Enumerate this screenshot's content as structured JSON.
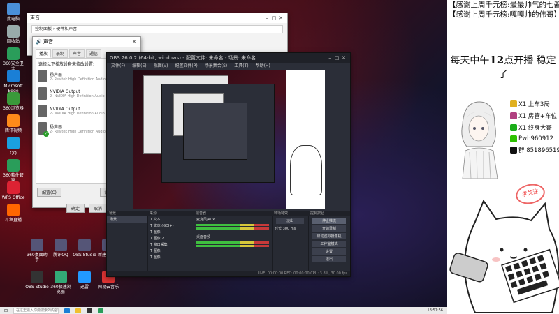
{
  "desktop": {
    "icons": [
      {
        "label": "此电脑",
        "color": "#4a8fd8"
      },
      {
        "label": "回收站",
        "color": "#9aa"
      },
      {
        "label": "360安全卫士",
        "color": "#2a9d5a"
      },
      {
        "label": "Microsoft Edge",
        "color": "#1a7fd6"
      },
      {
        "label": "360浏览器",
        "color": "#3a9a3a"
      },
      {
        "label": "腾讯视频",
        "color": "#ff8a1a"
      },
      {
        "label": "QQ",
        "color": "#1aa0e0"
      },
      {
        "label": "360软件管家",
        "color": "#2a9d5a"
      },
      {
        "label": "WPS Office",
        "color": "#d23"
      },
      {
        "label": "斗鱼直播",
        "color": "#f60"
      }
    ],
    "taskbar_icons": [
      {
        "label": "OBS Studio",
        "color": "#333"
      },
      {
        "label": "360极速浏览器",
        "color": "#3a7"
      },
      {
        "label": "迅雷",
        "color": "#29f"
      },
      {
        "label": "网易云音乐",
        "color": "#d33"
      }
    ],
    "bottom_icons": [
      "360桌面助手",
      "腾讯QQ",
      "OBS Studio",
      "新建文本文档"
    ]
  },
  "explorer": {
    "title": "声音",
    "address": "控制面板 › 硬件和声音"
  },
  "sound_dialog": {
    "title": "声音",
    "tabs": [
      "播放",
      "录制",
      "声音",
      "通信"
    ],
    "hint": "选择以下播放设备来修改设置:",
    "devices": [
      {
        "name": "扬声器",
        "sub": "2- Realtek High Definition Audio",
        "ok": false
      },
      {
        "name": "NVIDIA Output",
        "sub": "2- NVIDIA High Definition Audio",
        "ok": false
      },
      {
        "name": "NVIDIA Output",
        "sub": "2- NVIDIA High Definition Audio",
        "ok": false
      },
      {
        "name": "扬声器",
        "sub": "2- Realtek High Definition Audio",
        "ok": true
      }
    ],
    "configure": "配置(C)",
    "set_default": "设为默认值(S)",
    "properties": "属性(P)",
    "ok": "确定",
    "cancel": "取消"
  },
  "obs": {
    "title": "OBS 26.0.2 (64-bit, windows) - 配置文件: 未命名 - 场景: 未命名",
    "menu": [
      "文件(F)",
      "编辑(E)",
      "视图(V)",
      "配置文件(P)",
      "场景集合(S)",
      "工具(T)",
      "帮助(H)"
    ],
    "docks": {
      "scenes": "场景",
      "sources": "来源",
      "mixer": "混音器",
      "transitions": "转场特效",
      "controls": "控制按钮"
    },
    "sources": [
      "文本",
      "文本 (GDI+)",
      "图像",
      "图像 2",
      "窗口采集",
      "图像",
      "图像"
    ],
    "mixer": [
      "麦克风/Aux",
      "桌面音频"
    ],
    "transition": "淡出",
    "duration_label": "时长",
    "duration": "300 ms",
    "controls": [
      "停止推流",
      "开始录制",
      "启动虚拟摄像机",
      "工作室模式",
      "设置",
      "退出"
    ],
    "status": "LIVE: 00:00:00  REC: 00:00:00  CPU: 3.8%, 30.00 fps"
  },
  "taskbar": {
    "search": "在这里输入你要搜索的内容",
    "time": "13:51:56"
  },
  "overlay": {
    "banner_1": "【感谢上周千元榜:最最帅气的七酱】",
    "banner_2": "【感谢上周千元榜:嘎嘎帅的伟哥】",
    "schedule_prefix": "每天中午",
    "schedule_hour": "12",
    "schedule_suffix": "点开播 稳定了",
    "rows": [
      {
        "icon": "gold-card-icon",
        "color": "#e0b020",
        "text": "X1 上车3局"
      },
      {
        "icon": "car-icon",
        "color": "#b04080",
        "text": "X1 房管+车位"
      },
      {
        "icon": "wechat-pay-icon",
        "color": "#1aad19",
        "text": "X1 终身大哥"
      },
      {
        "icon": "wechat-icon",
        "color": "#2dc100",
        "text": "Pwh960912"
      },
      {
        "icon": "qq-icon",
        "color": "#111111",
        "text": "群 851896519"
      }
    ],
    "stamp": "求关注"
  }
}
